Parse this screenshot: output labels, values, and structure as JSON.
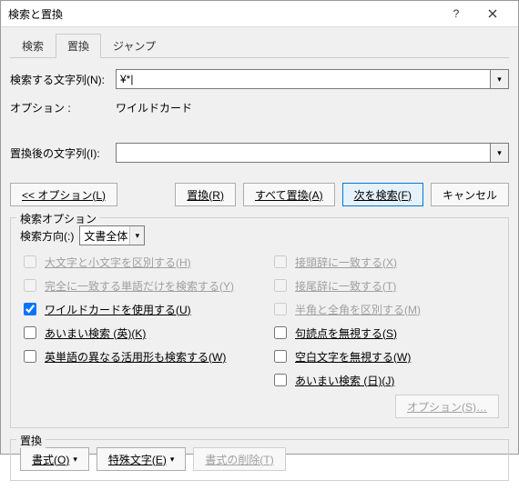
{
  "title": "検索と置換",
  "tabs": {
    "find": "検索",
    "replace": "置換",
    "goto": "ジャンプ"
  },
  "form": {
    "find_label": "検索する文字列(N):",
    "find_value": "¥*|",
    "options_label": "オプション :",
    "options_value": "ワイルドカード",
    "replace_label": "置換後の文字列(I):",
    "replace_value": ""
  },
  "buttons": {
    "less": "<< オプション(L)",
    "replace": "置換(R)",
    "replace_all": "すべて置換(A)",
    "find_next": "次を検索(F)",
    "cancel": "キャンセル"
  },
  "search_options": {
    "legend": "検索オプション",
    "dir_label": "検索方向(:)",
    "dir_value": "文書全体",
    "left": {
      "match_case": "大文字と小文字を区別する(H)",
      "whole_word": "完全に一致する単語だけを検索する(Y)",
      "wildcards": "ワイルドカードを使用する(U)",
      "sounds_like_en": "あいまい検索 (英)(K)",
      "word_forms_en": "英単語の異なる活用形も検索する(W)"
    },
    "right": {
      "prefix": "接頭辞に一致する(X)",
      "suffix": "接尾辞に一致する(T)",
      "width": "半角と全角を区別する(M)",
      "punct": "句読点を無視する(S)",
      "whitespace": "空白文字を無視する(W)",
      "sounds_like_jp": "あいまい検索 (日)(J)",
      "options_btn": "オプション(S)…"
    }
  },
  "replace_group": {
    "legend": "置換",
    "format_btn": "書式(O)",
    "special_btn": "特殊文字(E)",
    "clear_btn": "書式の削除(T)"
  }
}
